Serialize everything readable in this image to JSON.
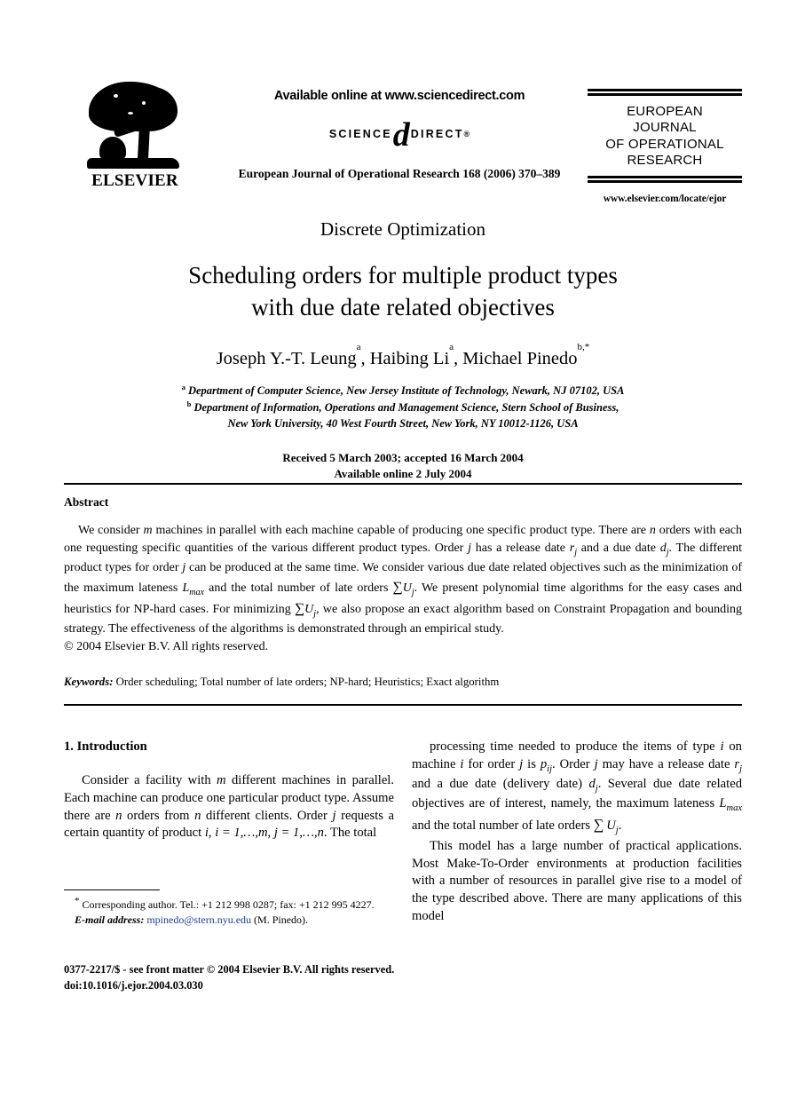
{
  "header": {
    "publisher": "ELSEVIER",
    "available_online": "Available online at www.sciencedirect.com",
    "sciencedirect_left": "SCIENCE",
    "sciencedirect_at": "d",
    "sciencedirect_right": "DIRECT",
    "sciencedirect_reg": "®",
    "journal_citation": "European Journal of Operational Research 168 (2006) 370–389",
    "journal_name_line1": "EUROPEAN",
    "journal_name_line2": "JOURNAL",
    "journal_name_line3": "OF OPERATIONAL",
    "journal_name_line4": "RESEARCH",
    "journal_url": "www.elsevier.com/locate/ejor"
  },
  "article": {
    "section_kind": "Discrete Optimization",
    "title_line1": "Scheduling orders for multiple product types",
    "title_line2": "with due date related objectives",
    "authors_text": "Joseph Y.-T. Leung a, Haibing Li a, Michael Pinedo b,*",
    "authors": [
      {
        "name": "Joseph Y.-T. Leung",
        "marks": "a"
      },
      {
        "name": "Haibing Li",
        "marks": "a"
      },
      {
        "name": "Michael Pinedo",
        "marks": "b,*"
      }
    ],
    "affiliations": [
      {
        "mark": "a",
        "text": "Department of Computer Science, New Jersey Institute of Technology, Newark, NJ 07102, USA"
      },
      {
        "mark": "b",
        "text": "Department of Information, Operations and Management Science, Stern School of Business,"
      },
      {
        "mark": "",
        "text": "New York University, 40 West Fourth Street, New York, NY 10012-1126, USA"
      }
    ],
    "received": "Received 5 March 2003; accepted 16 March 2004",
    "available_online": "Available online 2 July 2004"
  },
  "abstract": {
    "heading": "Abstract",
    "body_part1": "We consider ",
    "body_m": "m",
    "body_part2": " machines in parallel with each machine capable of producing one specific product type. There are ",
    "body_n": "n",
    "body_part3": " orders with each one requesting specific quantities of the various different product types. Order ",
    "body_j1": "j",
    "body_part4": " has a release date ",
    "body_rj": "rj",
    "body_part5": " and a due date ",
    "body_dj": "dj",
    "body_part6": ". The different product types for order ",
    "body_j2": "j",
    "body_part7": " can be produced at the same time. We consider various due date related objectives such as the minimization of the maximum lateness ",
    "body_lmax": "Lmax",
    "body_part8": " and the total number of late orders ",
    "body_sumuj1": "∑Uj",
    "body_part9": ". We present polynomial time algorithms for the easy cases and heuristics for NP-hard cases. For minimizing ",
    "body_sumuj2": "∑Uj",
    "body_part10": ", we also propose an exact algorithm based on Constraint Propagation and bounding strategy. The effectiveness of the algorithms is demonstrated through an empirical study.",
    "copyright": "© 2004 Elsevier B.V. All rights reserved."
  },
  "keywords": {
    "label": "Keywords:",
    "value": "Order scheduling; Total number of late orders; NP-hard; Heuristics; Exact algorithm"
  },
  "body": {
    "left_heading": "1. Introduction",
    "left_para_p1": "Consider a facility with ",
    "left_para_m": "m",
    "left_para_p2": " different machines in parallel. Each machine can produce one particular product type. Assume there are ",
    "left_para_n": "n",
    "left_para_p3": " orders from ",
    "left_para_n2": "n",
    "left_para_p4": " different clients. Order ",
    "left_para_j": "j",
    "left_para_p5": " requests a certain quantity of product ",
    "left_para_i": "i",
    "left_para_p6": ", ",
    "left_para_range1": "i = 1,…,m",
    "left_para_p7": ", ",
    "left_para_range2": "j = 1,…,n",
    "left_para_p8": ". The total",
    "right_para1_p1": "processing time needed to produce the items of type ",
    "right_para1_i": "i",
    "right_para1_p2": " on machine ",
    "right_para1_i2": "i",
    "right_para1_p3": " for order ",
    "right_para1_j": "j",
    "right_para1_p4": " is ",
    "right_para1_pij": "pij",
    "right_para1_p5": ". Order ",
    "right_para1_j2": "j",
    "right_para1_p6": " may have a release date ",
    "right_para1_rj": "rj",
    "right_para1_p7": " and a due date (delivery date) ",
    "right_para1_dj": "dj",
    "right_para1_p8": ". Several due date related objectives are of interest, namely, the maximum lateness ",
    "right_para1_lmax": "Lmax",
    "right_para1_p9": " and the total number of late orders ",
    "right_para1_sum": "∑Uj",
    "right_para1_p10": ".",
    "right_para2": "This model has a large number of practical applications. Most Make-To-Order environments at production facilities with a number of resources in parallel give rise to a model of the type described above. There are many applications of this model"
  },
  "footnote": {
    "star": "*",
    "corresponding": " Corresponding author. Tel.: +1 212 998 0287; fax: +1 212 995 4227.",
    "email_label": "E-mail address:",
    "email": "mpinedo@stern.nyu.edu",
    "email_owner": "(M. Pinedo).",
    "email_color": "#1e3f9e"
  },
  "imprint": {
    "line1": "0377-2217/$ - see front matter © 2004 Elsevier B.V. All rights reserved.",
    "line2": "doi:10.1016/j.ejor.2004.03.030"
  }
}
